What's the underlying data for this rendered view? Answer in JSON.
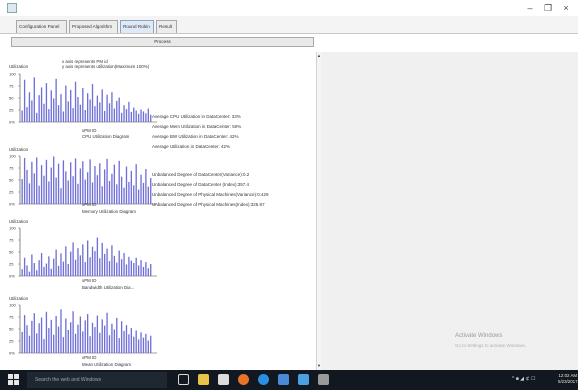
{
  "window": {
    "minimize": "–",
    "maximize": "❐",
    "close": "×"
  },
  "tabs": [
    {
      "label": "Configuration Panel"
    },
    {
      "label": "Proposed Algorithm"
    },
    {
      "label": "Round Robin"
    },
    {
      "label": "Result"
    }
  ],
  "process_button": "Process",
  "legend": {
    "line1": "x axis represents PM id",
    "line2": "y axis represents utilization(Maximum 100%)"
  },
  "colors": {
    "bar": "#6f6fd8",
    "taskbar": "#111820"
  },
  "charts": [
    {
      "ylabel": "Utilization",
      "xlabel": "xPM ID",
      "caption": "CPU Utilization Diagram"
    },
    {
      "ylabel": "Utilization",
      "xlabel": "xPM ID",
      "caption": "Memory Utilization Diagram"
    },
    {
      "ylabel": "Utilization",
      "xlabel": "xPM ID",
      "caption": "Bandwidth Utilization Dia..."
    },
    {
      "ylabel": "Utilization",
      "xlabel": "xPM ID",
      "caption": "Mean Utilization Diagram"
    }
  ],
  "tick_labels": [
    "100",
    "75",
    "50",
    "25",
    "0%"
  ],
  "stats": [
    "Average CPU Utilization in DataCenter:  33%",
    "Average Mem Utilization in DataCenter:  50%",
    "Average BW Utilization in DataCenter:  42%",
    "Average Utilization in DataCenter:  42%"
  ],
  "unbalanced": [
    "Unbalanced Degree of DataCenter(Variance):0.2",
    "Unbalanced Degree of DataCenter (Index):357.4",
    "Unbalanced Degree of Physical Machines(Variance):0.429",
    "Unbalanced Degree of Physical Machines(Index):325.97"
  ],
  "watermark": {
    "title": "Activate Windows",
    "subtitle": "Go to Settings to activate Windows."
  },
  "taskbar": {
    "search_placeholder": "Search the web and Windows",
    "time": "12:02 AM",
    "date": "5/23/2017",
    "tray_text": "^ ■ ◢ ⊄ ☐"
  },
  "chart_data": [
    {
      "type": "bar",
      "title": "CPU Utilization Diagram",
      "xlabel": "xPM ID",
      "ylabel": "Utilization",
      "ylim": [
        0,
        100
      ],
      "values": [
        24,
        88,
        31,
        62,
        45,
        93,
        19,
        56,
        72,
        38,
        81,
        27,
        66,
        49,
        90,
        35,
        58,
        22,
        76,
        43,
        67,
        29,
        84,
        52,
        36,
        71,
        25,
        60,
        47,
        79,
        33,
        55,
        41,
        68,
        23,
        57,
        39,
        62,
        28,
        44,
        51,
        19,
        35,
        27,
        42,
        21,
        30,
        24,
        17,
        26,
        22,
        18,
        28,
        15
      ]
    },
    {
      "type": "bar",
      "title": "Memory Utilization Diagram",
      "xlabel": "xPM ID",
      "ylabel": "Utilization",
      "ylim": [
        0,
        100
      ],
      "values": [
        52,
        96,
        71,
        43,
        88,
        64,
        97,
        38,
        81,
        59,
        92,
        47,
        76,
        99,
        55,
        84,
        33,
        91,
        68,
        49,
        87,
        58,
        95,
        42,
        74,
        89,
        51,
        66,
        93,
        45,
        79,
        60,
        85,
        37,
        72,
        94,
        48,
        63,
        82,
        41,
        90,
        57,
        34,
        78,
        46,
        69,
        39,
        83,
        30,
        61,
        44,
        73,
        36,
        54
      ]
    },
    {
      "type": "bar",
      "title": "Bandwidth Utilization Dia...",
      "xlabel": "xPM ID",
      "ylabel": "Utilization",
      "ylim": [
        0,
        100
      ],
      "values": [
        14,
        38,
        22,
        9,
        45,
        27,
        12,
        33,
        48,
        19,
        26,
        41,
        15,
        36,
        55,
        21,
        47,
        30,
        62,
        25,
        51,
        70,
        34,
        58,
        43,
        66,
        29,
        74,
        39,
        61,
        52,
        80,
        37,
        69,
        46,
        57,
        31,
        64,
        42,
        28,
        53,
        35,
        48,
        24,
        40,
        32,
        27,
        38,
        22,
        33,
        19,
        29,
        16,
        25
      ]
    },
    {
      "type": "bar",
      "title": "Mean Utilization Diagram",
      "xlabel": "xPM ID",
      "ylabel": "Utilization",
      "ylim": [
        0,
        100
      ],
      "values": [
        44,
        79,
        58,
        36,
        67,
        83,
        41,
        62,
        74,
        29,
        86,
        52,
        69,
        38,
        77,
        55,
        91,
        33,
        72,
        48,
        64,
        87,
        40,
        59,
        76,
        45,
        68,
        81,
        35,
        63,
        54,
        78,
        42,
        70,
        57,
        84,
        37,
        61,
        49,
        73,
        31,
        66,
        46,
        58,
        39,
        52,
        34,
        47,
        28,
        43,
        32,
        40,
        26,
        36
      ]
    }
  ]
}
